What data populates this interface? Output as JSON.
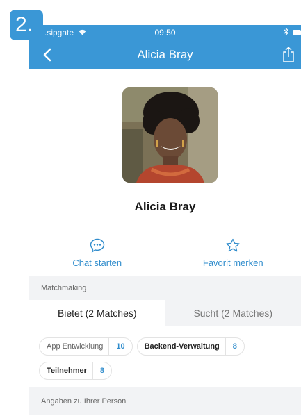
{
  "step_badge": "2.",
  "statusbar": {
    "carrier": ".sipgate",
    "time": "09:50"
  },
  "navbar": {
    "title": "Alicia Bray"
  },
  "profile": {
    "name": "Alicia Bray"
  },
  "actions": [
    {
      "label": "Chat starten",
      "icon": "chat-bubble-icon"
    },
    {
      "label": "Favorit merken",
      "icon": "star-icon"
    }
  ],
  "matchmaking": {
    "header": "Matchmaking",
    "tabs": [
      {
        "label": "Bietet (2 Matches)",
        "active": true
      },
      {
        "label": "Sucht (2 Matches)",
        "active": false
      }
    ],
    "chips": [
      {
        "label": "App Entwicklung",
        "count": "10"
      },
      {
        "label": "Backend-Verwaltung",
        "count": "8"
      },
      {
        "label": "Teilnehmer",
        "count": "8"
      }
    ]
  },
  "person_section": {
    "header": "Angaben zu Ihrer Person"
  },
  "colors": {
    "primary": "#3a97d6",
    "accent": "#2f8ccc",
    "section_bg": "#f2f3f5"
  }
}
